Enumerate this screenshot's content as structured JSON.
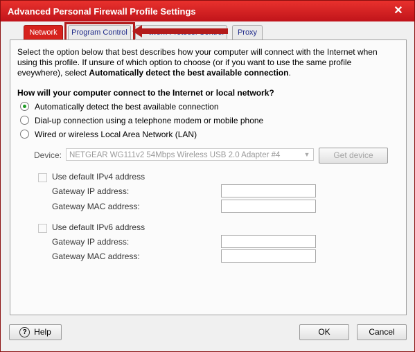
{
  "window": {
    "title": "Advanced Personal Firewall Profile Settings",
    "close_glyph": "✕"
  },
  "tabs": [
    {
      "label": "Network"
    },
    {
      "label": "Program Control"
    },
    {
      "label": "twork Protocol Control"
    },
    {
      "label": "Proxy"
    }
  ],
  "intro": {
    "line1": "Select the option below that best describes how your computer will connect with the Internet when",
    "line2": "using this profile. If unsure of which option to choose (or if you want to use the same profile",
    "line3": "eveywhere), select ",
    "line3_bold": "Automatically detect the best available connection",
    "line3_end": "."
  },
  "question": "How will your computer connect to the Internet or local network?",
  "options": [
    {
      "label": "Automatically detect the best available connection",
      "selected": true
    },
    {
      "label": "Dial-up connection using a telephone modem or mobile phone",
      "selected": false
    },
    {
      "label": "Wired or wireless Local Area Network (LAN)",
      "selected": false
    }
  ],
  "device": {
    "label": "Device:",
    "value": "NETGEAR WG111v2 54Mbps Wireless USB 2.0 Adapter #4",
    "button": "Get device"
  },
  "ipv4": {
    "checkbox": "Use default IPv4 address",
    "gateway_ip": "Gateway IP address:",
    "gateway_mac": "Gateway MAC address:"
  },
  "ipv6": {
    "checkbox": "Use default IPv6 address",
    "gateway_ip": "Gateway IP address:",
    "gateway_mac": "Gateway MAC address:"
  },
  "footer": {
    "help": "Help",
    "ok": "OK",
    "cancel": "Cancel"
  },
  "colors": {
    "titlebar": "#d41f1f",
    "highlight": "#b31b1b",
    "radio_selected": "#1f9b24"
  }
}
